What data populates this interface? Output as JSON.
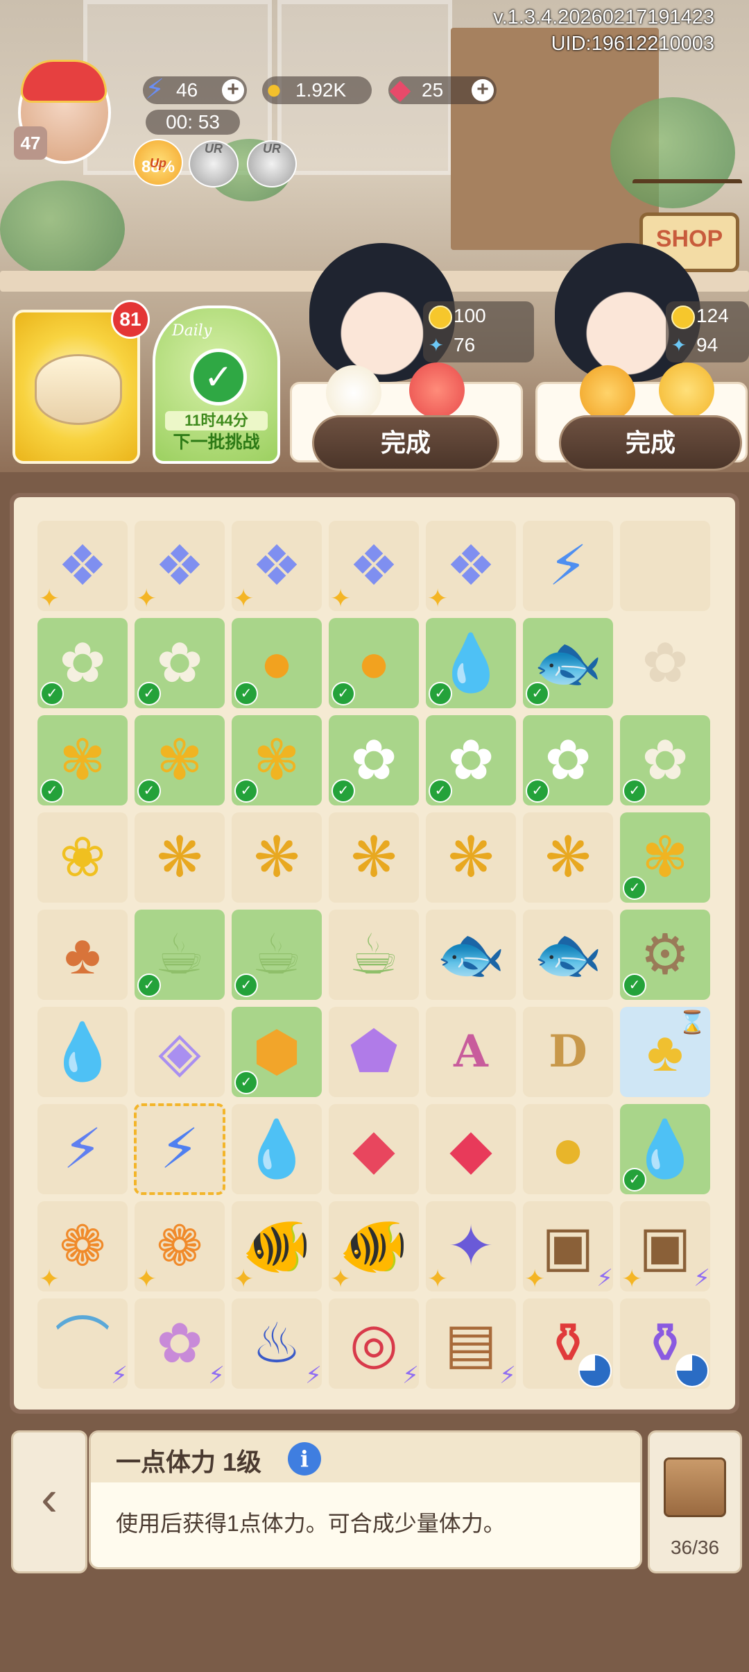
{
  "header": {
    "version": "v.1.3.4.20260217191423",
    "uid": "UID:19612210003",
    "player_level": "47",
    "energy": "46",
    "energy_timer": "00: 53",
    "coins": "1.92K",
    "gems": "25",
    "up_rate": "88%",
    "up_label": "Up",
    "ur_label": "UR",
    "shop_label": "SHOP"
  },
  "event_cards": {
    "gift_badge_count": "81",
    "daily_countdown": "11时44分",
    "daily_next": "下一批挑战",
    "daily_banner": "Daily"
  },
  "customers": [
    {
      "coin_reward": "100",
      "butterfly_reward": "76",
      "done_label": "完成"
    },
    {
      "coin_reward": "124",
      "butterfly_reward": "94",
      "done_label": "完成"
    }
  ],
  "board": {
    "rows": [
      [
        "energy-crystal-cluster",
        "energy-crystal-cluster",
        "energy-crystal-cluster",
        "energy-crystal-cluster",
        "energy-crystal-cluster",
        "energy-bubble",
        ""
      ],
      [
        "lily-ready",
        "lily-ready",
        "pepper-ready",
        "pepper-ready",
        "water-drop-ready",
        "goldfish-ready",
        "flower-watermark"
      ],
      [
        "osmanthus-ready",
        "osmanthus-ready",
        "osmanthus-ready",
        "cat-lily-ready",
        "cat-lily-ready",
        "cat-lily-ready",
        "lily-ready"
      ],
      [
        "yellow-flower-frog",
        "osmanthus-branch",
        "osmanthus-branch",
        "osmanthus-branch",
        "osmanthus-branch",
        "osmanthus-branch",
        "osmanthus-ready"
      ],
      [
        "glass-dome-tree",
        "cat-teacup-ready",
        "cat-teacup-ready",
        "cat-teacup",
        "koi-fish",
        "koi-fish",
        "dragonfly-gear-ready"
      ],
      [
        "purple-drop",
        "rainbow-gem",
        "amber-ready",
        "amethyst",
        "letter-a-book",
        "letter-d-calendar",
        "pineapple-timed"
      ],
      [
        "energy-bolts",
        "energy-bolt-selected",
        "purple-drop-face",
        "red-crystal-cluster",
        "ruby",
        "gold-coins",
        "water-drop-ready"
      ],
      [
        "trumpet-flower",
        "trumpet-flower",
        "goldfish-pair",
        "goldfish-pair",
        "galaxy-orb",
        "golden-chest",
        "golden-chest"
      ],
      [
        "garden-bridge",
        "flower-planter",
        "teapot-stove",
        "red-vortex",
        "wooden-shelf",
        "red-potion",
        "purple-potion"
      ]
    ]
  },
  "selected_item": {
    "title": "一点体力 1级",
    "description": "使用后获得1点体力。可合成少量体力。"
  },
  "storage": {
    "count": "36/36"
  },
  "colors": {
    "accent_green": "#24a23a",
    "alert_red": "#e43535",
    "info_blue": "#3f7ee0",
    "board_bg": "#f5ead3"
  }
}
